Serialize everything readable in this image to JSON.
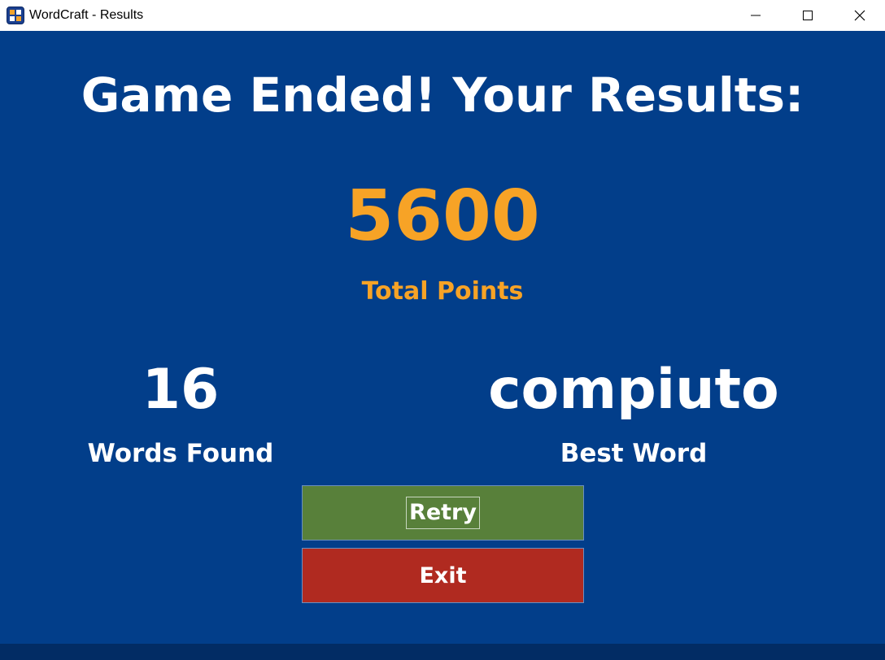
{
  "window": {
    "title": "WordCraft - Results",
    "icons": {
      "app": "wordcraft-app-icon",
      "minimize": "minimize-icon",
      "maximize": "maximize-icon",
      "close": "close-icon"
    }
  },
  "results": {
    "heading": "Game Ended! Your Results:",
    "total_points": "5600",
    "total_points_label": "Total Points",
    "words_found": "16",
    "words_found_label": "Words Found",
    "best_word": "compiuto",
    "best_word_label": "Best Word"
  },
  "buttons": {
    "retry_label": "Retry",
    "exit_label": "Exit"
  },
  "colors": {
    "background": "#023e8a",
    "score_accent": "#f7a326",
    "retry_button": "#58803a",
    "exit_button": "#b02a20",
    "text": "#ffffff"
  }
}
